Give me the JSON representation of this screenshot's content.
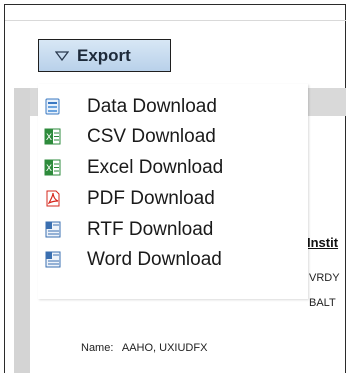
{
  "export": {
    "label": "Export",
    "menu": [
      {
        "icon": "data-download-icon",
        "label": "Data Download"
      },
      {
        "icon": "csv-file-icon",
        "label": "CSV Download"
      },
      {
        "icon": "excel-file-icon",
        "label": "Excel Download"
      },
      {
        "icon": "pdf-file-icon",
        "label": "PDF Download"
      },
      {
        "icon": "rtf-file-icon",
        "label": "RTF Download"
      },
      {
        "icon": "word-file-icon",
        "label": "Word Download"
      }
    ]
  },
  "background": {
    "column_header": "Instit",
    "row1": "VRDY",
    "row2": "BALT",
    "name_label": "Name:",
    "name_value": "AAHO, UXIUDFX"
  },
  "colors": {
    "button_top": "#d8e7f5",
    "button_bottom": "#b9d1ea",
    "header_gray": "#d9d9d9",
    "excel_green": "#2e8b3c",
    "pdf_red": "#d6281e",
    "doc_blue": "#3a6fb0"
  }
}
